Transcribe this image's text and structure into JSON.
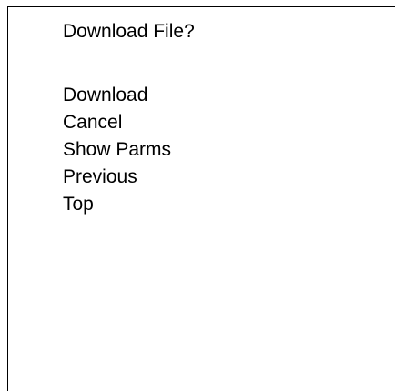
{
  "dialog": {
    "title": "Download File?",
    "options": [
      {
        "label": "Download"
      },
      {
        "label": "Cancel"
      },
      {
        "label": "Show Parms"
      },
      {
        "label": "Previous"
      },
      {
        "label": "Top"
      }
    ]
  }
}
